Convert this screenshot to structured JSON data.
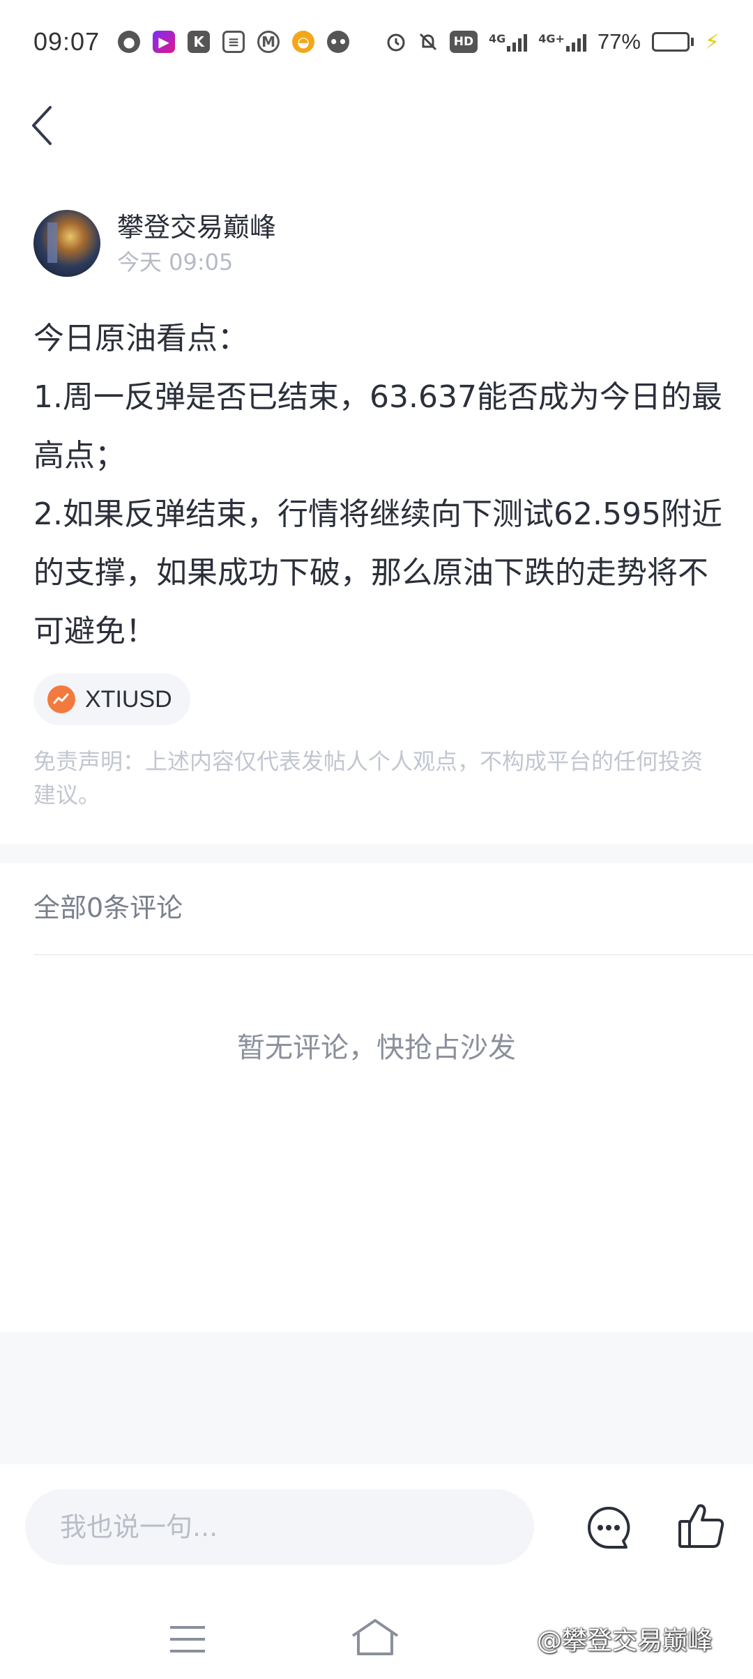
{
  "status_bar": {
    "time": "09:07",
    "hd_label": "HD",
    "net1": "4G",
    "net2": "4G+",
    "battery_percent": "77%",
    "battery_level": 0.77,
    "app_icons": [
      "qq-icon",
      "video-app-icon",
      "k-app-icon",
      "notes-app-icon",
      "bank-app-icon",
      "orange-app-icon",
      "wechat-icon"
    ]
  },
  "header": {
    "back_icon": "chevron-left-icon"
  },
  "post": {
    "author_name": "攀登交易巅峰",
    "time": "今天 09:05",
    "lines": [
      "今日原油看点：",
      "1.周一反弹是否已结束，63.637能否成为今日的最高点；",
      "2.如果反弹结束，行情将继续向下测试62.595附近的支撑，如果成功下破，那么原油下跌的走势将不可避免！"
    ],
    "tag_label": "XTIUSD",
    "disclaimer": "免责声明：上述内容仅代表发帖人个人观点，不构成平台的任何投资建议。"
  },
  "comments": {
    "title": "全部0条评论",
    "empty_text": "暂无评论，快抢占沙发"
  },
  "bottom_bar": {
    "input_placeholder": "我也说一句...",
    "chat_icon": "chat-bubble-icon",
    "like_icon": "thumbs-up-icon"
  },
  "system_nav": {
    "watermark": "@攀登交易巅峰"
  },
  "colors": {
    "accent_orange": "#f37a3e",
    "text_primary": "#2b2f3a",
    "text_muted": "#b6bac5",
    "battery_green": "#3bd13b"
  }
}
